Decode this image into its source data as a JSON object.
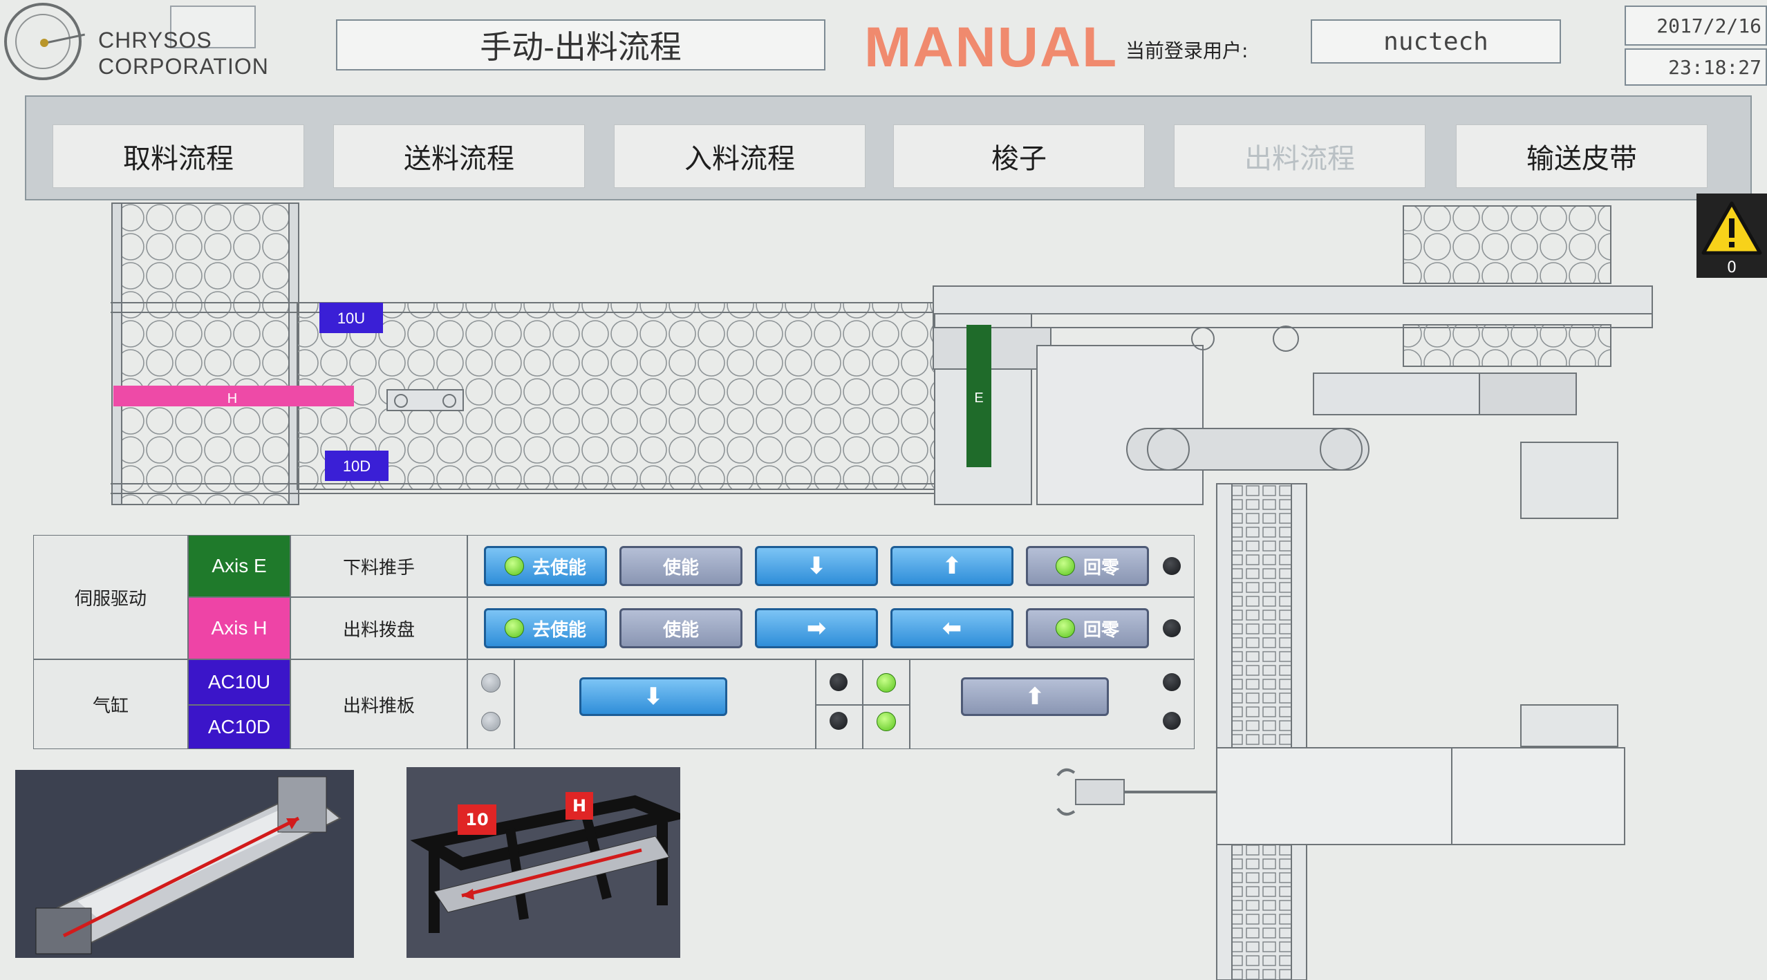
{
  "brand": {
    "line1": "CHRYSOS",
    "line2": "CORPORATION"
  },
  "header": {
    "title": "手动-出料流程",
    "mode": "MANUAL",
    "user_label": "当前登录用户:",
    "user_name": "nuctech",
    "date": "2017/2/16",
    "time": "23:18:27"
  },
  "tabs": [
    {
      "label": "取料流程"
    },
    {
      "label": "送料流程"
    },
    {
      "label": "入料流程"
    },
    {
      "label": "梭子"
    },
    {
      "label": "出料流程",
      "active": true
    },
    {
      "label": "输送皮带"
    }
  ],
  "alarm": {
    "count": "0"
  },
  "machine": {
    "labels": {
      "up": "10U",
      "down": "10D",
      "h": "H",
      "e": "E"
    },
    "colors": {
      "up": "#3a1fd6",
      "h": "#ee4aa7",
      "e": "#1f6b2a"
    }
  },
  "control": {
    "servo_group": "伺服驱动",
    "cylinder_group": "气缸",
    "axes": [
      {
        "name": "Axis E",
        "color": "#1f7a2b",
        "function": "下料推手"
      },
      {
        "name": "Axis H",
        "color": "#ee44a6",
        "function": "出料拨盘"
      }
    ],
    "cylinders": [
      {
        "name": "AC10U",
        "color": "#3b15c9"
      },
      {
        "name": "AC10D",
        "color": "#3b15c9"
      }
    ],
    "cylinder_function": "出料推板",
    "btn_disable": "去使能",
    "btn_enable": "使能",
    "btn_home": "回零",
    "arrow_down": "⬇",
    "arrow_up": "⬆",
    "arrow_right": "➡",
    "arrow_left": "⬅"
  },
  "previews": {
    "left_tags": [],
    "right_tags": [
      "10",
      "H"
    ]
  }
}
